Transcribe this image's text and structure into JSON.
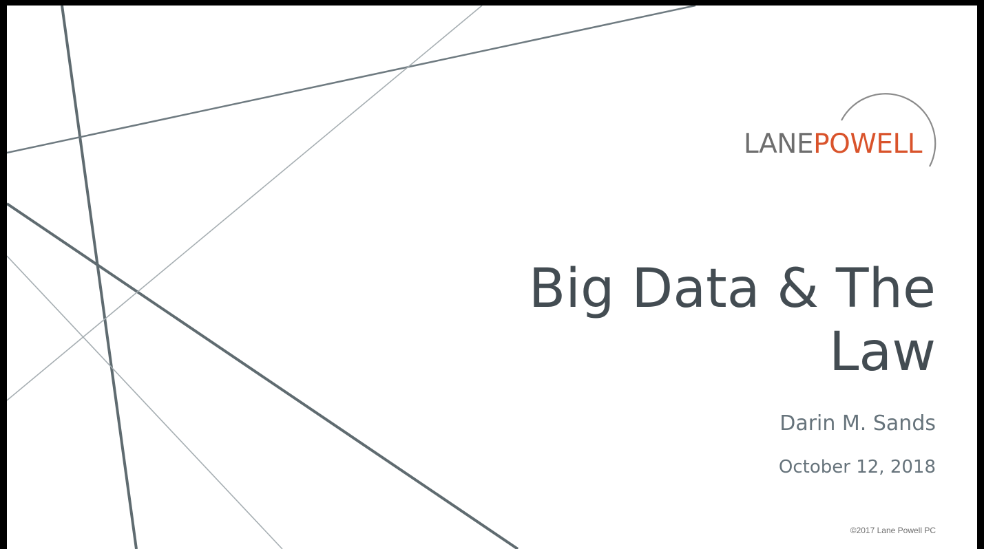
{
  "logo": {
    "lane": "LANE",
    "powell": "POWELL",
    "colors": {
      "lane": "#6e6e6e",
      "powell": "#d9532b",
      "arc": "#8a8a8a"
    }
  },
  "slide": {
    "title": "Big Data & The Law",
    "author": "Darin M. Sands",
    "date": "October 12, 2018",
    "copyright": "©2017 Lane Powell PC"
  },
  "theme": {
    "title_color": "#434c52",
    "subtitle_color": "#66737b",
    "line_color": "#5f6b70"
  }
}
